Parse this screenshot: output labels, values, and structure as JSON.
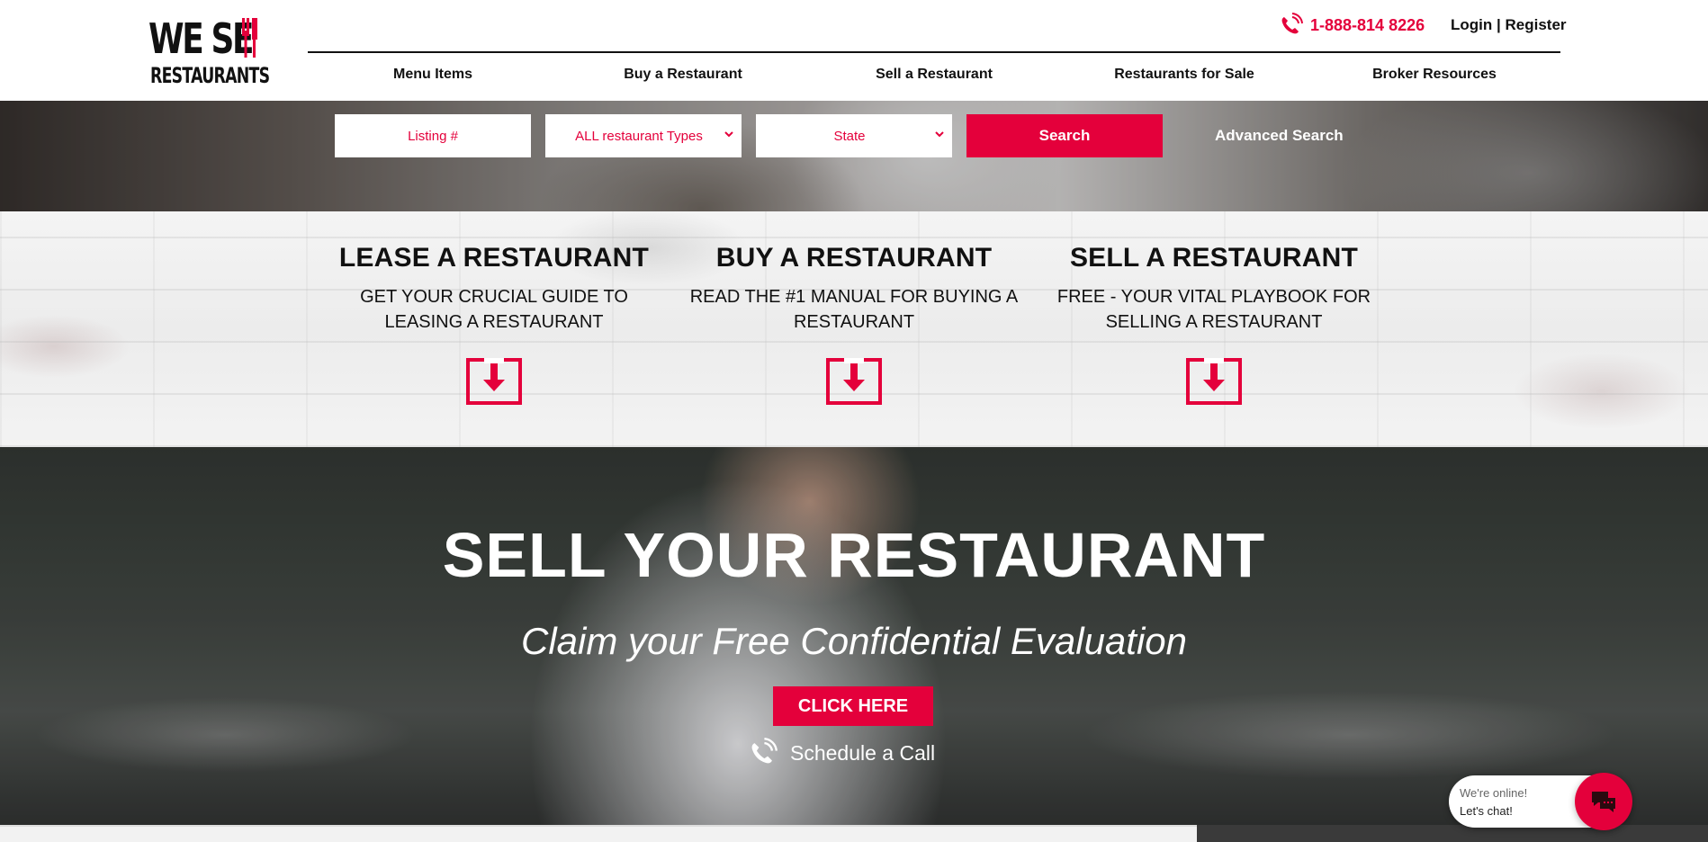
{
  "brand": {
    "logo_line1": "WE SE",
    "logo_line2": "RESTAURANTS",
    "accent": "#e4003b"
  },
  "header": {
    "phone": "1-888-814 8226",
    "login": "Login",
    "separator": "|",
    "register": "Register"
  },
  "nav": {
    "items": [
      {
        "label": "Menu Items"
      },
      {
        "label": "Buy a Restaurant"
      },
      {
        "label": "Sell a Restaurant"
      },
      {
        "label": "Restaurants for Sale"
      },
      {
        "label": "Broker Resources"
      }
    ]
  },
  "search": {
    "listing_placeholder": "Listing #",
    "type_selected": "ALL restaurant Types",
    "state_selected": "State",
    "search_label": "Search",
    "advanced_label": "Advanced Search"
  },
  "guides": [
    {
      "title": "LEASE A RESTAURANT",
      "desc": "GET YOUR CRUCIAL GUIDE TO LEASING A RESTAURANT",
      "icon": "download-icon"
    },
    {
      "title": "BUY A RESTAURANT",
      "desc": "READ THE #1 MANUAL FOR BUYING A RESTAURANT",
      "icon": "download-icon"
    },
    {
      "title": "SELL A RESTAURANT",
      "desc": "FREE - YOUR VITAL PLAYBOOK FOR SELLING A RESTAURANT",
      "icon": "download-icon"
    }
  ],
  "hero": {
    "title": "SELL YOUR RESTAURANT",
    "subtitle": "Claim your Free Confidential Evaluation",
    "cta": "CLICK HERE",
    "schedule": "Schedule a Call"
  },
  "chat": {
    "line1": "We're online!",
    "line2": "Let's chat!"
  }
}
